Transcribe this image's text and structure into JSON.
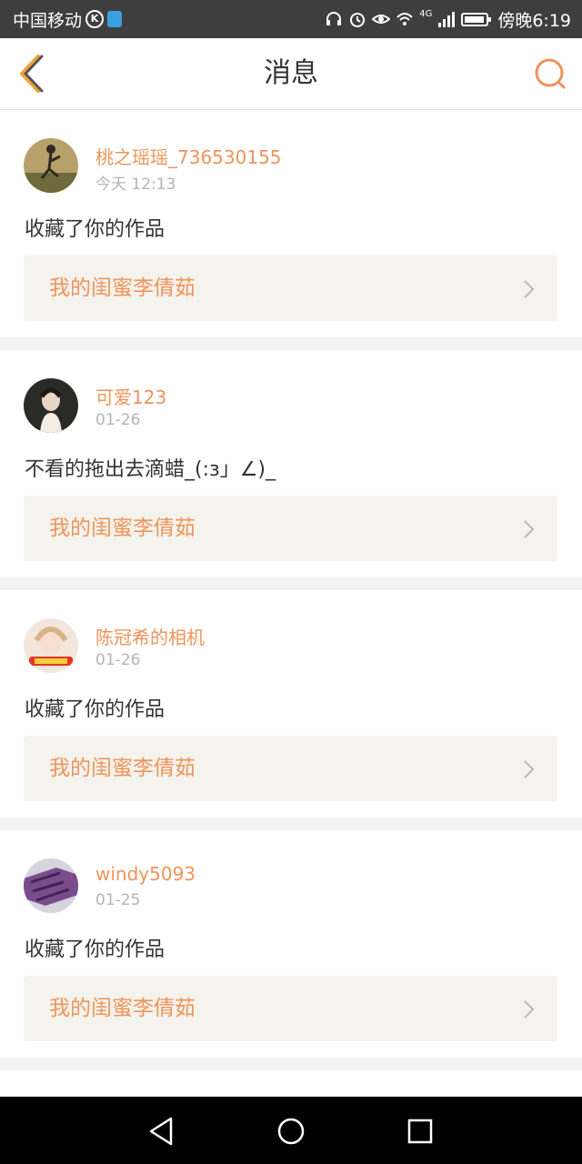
{
  "status_bar": {
    "carrier": "中国移动",
    "k_badge": "K",
    "network": "4G",
    "time": "傍晚6:19"
  },
  "header": {
    "title": "消息",
    "back_icon": "back-chevron-icon",
    "search_icon": "search-icon"
  },
  "colors": {
    "accent": "#f0935a",
    "status_bar": "#3e3e3e",
    "card_bg": "#ffffff",
    "work_bg": "#f4f3ee",
    "nav_bar": "#000000"
  },
  "messages": [
    {
      "user": "桃之瑶瑶_736530155",
      "time": "今天 12:13",
      "text": "收藏了你的作品",
      "work_title": "我的闺蜜李倩茹"
    },
    {
      "user": "可爱123",
      "time": "01-26",
      "text": "不看的拖出去滴蜡_(:з」∠)_",
      "work_title": "我的闺蜜李倩茹"
    },
    {
      "user": "陈冠希的相机",
      "time": "01-26",
      "text": "收藏了你的作品",
      "work_title": "我的闺蜜李倩茹"
    },
    {
      "user": "windy5093",
      "time": "01-25",
      "text": "收藏了你的作品",
      "work_title": "我的闺蜜李倩茹"
    }
  ]
}
